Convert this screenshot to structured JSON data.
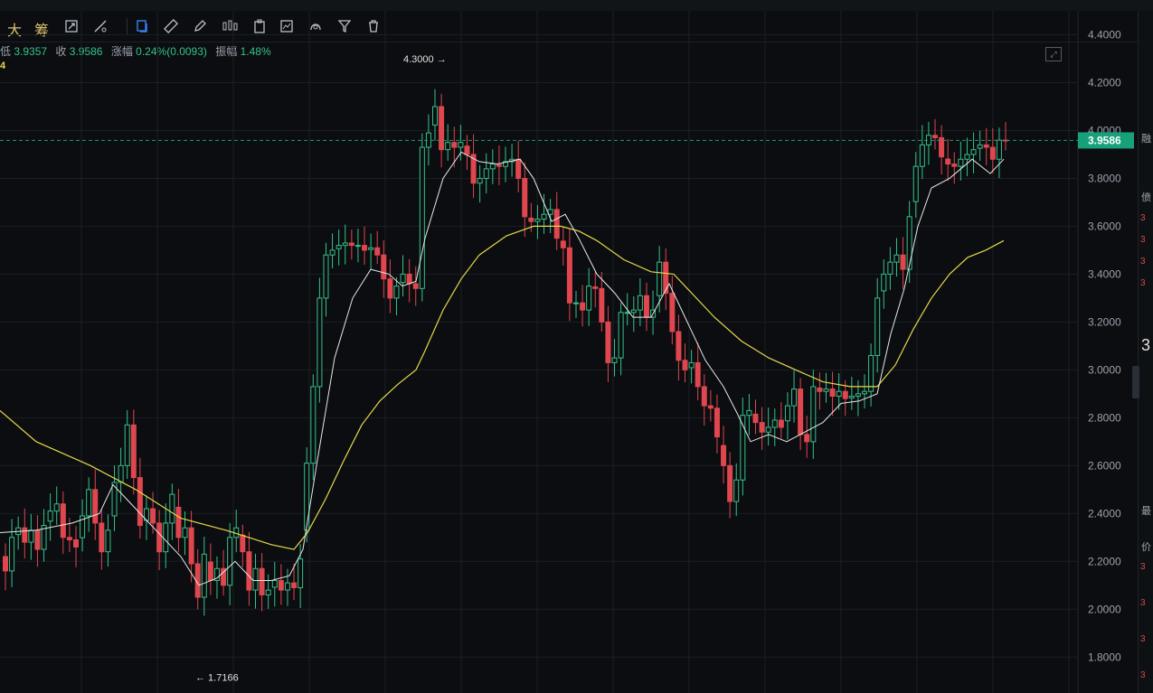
{
  "toolbar": {
    "label_da": "大",
    "label_chou": "筹",
    "icons": [
      "resize-icon",
      "line-tool-icon",
      "copy-icon",
      "ruler-icon",
      "pen-icon",
      "candles-icon",
      "clipboard-icon",
      "chart-edit-icon",
      "shape-icon",
      "filter-icon",
      "trash-icon"
    ]
  },
  "infobar": {
    "low_label": "低",
    "low_value": "3.9357",
    "close_label": "收",
    "close_value": "3.9586",
    "change_label": "涨幅",
    "change_value": "0.24%(0.0093)",
    "amplitude_label": "振幅",
    "amplitude_value": "1.48%"
  },
  "indicator_tag": "4",
  "colors": {
    "up": "#35c28a",
    "down": "#e0464e",
    "ma_white": "#e8e8e8",
    "ma_yellow": "#e6d84a",
    "price_tag_bg": "#17a07a",
    "grid": "#1b1f25"
  },
  "chart_data": {
    "type": "candlestick",
    "ylim": [
      1.65,
      4.5
    ],
    "yticks": [
      "4.4000",
      "4.2000",
      "4.0000",
      "3.8000",
      "3.6000",
      "3.4000",
      "3.2000",
      "3.0000",
      "2.8000",
      "2.6000",
      "2.4000",
      "2.2000",
      "2.0000",
      "1.8000"
    ],
    "current_price": "3.9586",
    "high_annotation": {
      "label": "4.3000 →",
      "value": 4.3
    },
    "low_annotation": {
      "label": "← 1.7166",
      "value": 1.7166
    },
    "closes": [
      2.16,
      2.3,
      2.34,
      2.28,
      2.33,
      2.25,
      2.35,
      2.41,
      2.44,
      2.3,
      2.29,
      2.26,
      2.39,
      2.5,
      2.36,
      2.24,
      2.33,
      2.53,
      2.6,
      2.77,
      2.55,
      2.35,
      2.42,
      2.36,
      2.24,
      2.36,
      2.48,
      2.3,
      2.34,
      2.19,
      2.05,
      2.23,
      2.12,
      2.17,
      2.1,
      2.3,
      2.34,
      2.24,
      2.08,
      2.17,
      2.06,
      2.08,
      2.12,
      2.08,
      2.11,
      2.09,
      2.21,
      2.61,
      2.93,
      3.3,
      3.48,
      3.5,
      3.52,
      3.53,
      3.52,
      3.52,
      3.5,
      3.51,
      3.48,
      3.38,
      3.3,
      3.35,
      3.4,
      3.36,
      3.34,
      3.93,
      3.99,
      4.1,
      3.92,
      3.95,
      3.93,
      3.95,
      3.9,
      3.78,
      3.8,
      3.84,
      3.86,
      3.85,
      3.87,
      3.88,
      3.8,
      3.64,
      3.62,
      3.63,
      3.65,
      3.67,
      3.55,
      3.51,
      3.28,
      3.28,
      3.25,
      3.35,
      3.34,
      3.2,
      3.03,
      3.05,
      3.24,
      3.24,
      3.25,
      3.31,
      3.22,
      3.25,
      3.45,
      3.32,
      3.16,
      3.04,
      3.0,
      3.03,
      2.93,
      2.85,
      2.84,
      2.72,
      2.6,
      2.45,
      2.54,
      2.81,
      2.83,
      2.78,
      2.74,
      2.76,
      2.79,
      2.76,
      2.85,
      2.92,
      2.73,
      2.7,
      2.93,
      2.91,
      2.92,
      2.89,
      2.91,
      2.88,
      2.89,
      2.9,
      2.91,
      3.06,
      3.3,
      3.4,
      3.45,
      3.48,
      3.42,
      3.64,
      3.85,
      3.94,
      3.98,
      3.97,
      3.89,
      3.86,
      3.85,
      3.88,
      3.9,
      3.92,
      3.94,
      3.93,
      3.88,
      3.96,
      3.9586
    ],
    "ma_yellow": [
      [
        0,
        2.83
      ],
      [
        40,
        2.7
      ],
      [
        100,
        2.6
      ],
      [
        150,
        2.5
      ],
      [
        200,
        2.38
      ],
      [
        250,
        2.33
      ],
      [
        300,
        2.27
      ],
      [
        325,
        2.25
      ],
      [
        340,
        2.32
      ],
      [
        360,
        2.46
      ],
      [
        380,
        2.62
      ],
      [
        400,
        2.77
      ],
      [
        420,
        2.87
      ],
      [
        440,
        2.94
      ],
      [
        460,
        3.0
      ],
      [
        470,
        3.08
      ],
      [
        490,
        3.25
      ],
      [
        510,
        3.38
      ],
      [
        530,
        3.48
      ],
      [
        560,
        3.56
      ],
      [
        590,
        3.6
      ],
      [
        620,
        3.6
      ],
      [
        640,
        3.58
      ],
      [
        660,
        3.54
      ],
      [
        690,
        3.46
      ],
      [
        720,
        3.41
      ],
      [
        745,
        3.4
      ],
      [
        760,
        3.34
      ],
      [
        790,
        3.22
      ],
      [
        820,
        3.12
      ],
      [
        850,
        3.05
      ],
      [
        880,
        3.0
      ],
      [
        910,
        2.95
      ],
      [
        940,
        2.93
      ],
      [
        970,
        2.93
      ],
      [
        990,
        3.02
      ],
      [
        1010,
        3.17
      ],
      [
        1030,
        3.3
      ],
      [
        1050,
        3.4
      ],
      [
        1070,
        3.47
      ],
      [
        1090,
        3.5
      ],
      [
        1110,
        3.54
      ]
    ],
    "ma_white": [
      [
        0,
        2.32
      ],
      [
        40,
        2.33
      ],
      [
        80,
        2.36
      ],
      [
        110,
        2.4
      ],
      [
        125,
        2.52
      ],
      [
        140,
        2.46
      ],
      [
        160,
        2.38
      ],
      [
        180,
        2.3
      ],
      [
        200,
        2.22
      ],
      [
        220,
        2.1
      ],
      [
        240,
        2.13
      ],
      [
        260,
        2.2
      ],
      [
        280,
        2.12
      ],
      [
        300,
        2.12
      ],
      [
        320,
        2.14
      ],
      [
        335,
        2.25
      ],
      [
        350,
        2.6
      ],
      [
        370,
        3.05
      ],
      [
        390,
        3.3
      ],
      [
        410,
        3.42
      ],
      [
        430,
        3.4
      ],
      [
        445,
        3.35
      ],
      [
        460,
        3.37
      ],
      [
        470,
        3.55
      ],
      [
        490,
        3.8
      ],
      [
        510,
        3.91
      ],
      [
        530,
        3.87
      ],
      [
        550,
        3.86
      ],
      [
        575,
        3.88
      ],
      [
        590,
        3.8
      ],
      [
        610,
        3.62
      ],
      [
        625,
        3.65
      ],
      [
        640,
        3.55
      ],
      [
        660,
        3.4
      ],
      [
        680,
        3.32
      ],
      [
        700,
        3.22
      ],
      [
        720,
        3.22
      ],
      [
        740,
        3.36
      ],
      [
        760,
        3.2
      ],
      [
        780,
        3.04
      ],
      [
        800,
        2.93
      ],
      [
        815,
        2.82
      ],
      [
        830,
        2.7
      ],
      [
        850,
        2.73
      ],
      [
        870,
        2.7
      ],
      [
        890,
        2.74
      ],
      [
        910,
        2.78
      ],
      [
        930,
        2.86
      ],
      [
        950,
        2.87
      ],
      [
        970,
        2.9
      ],
      [
        985,
        3.15
      ],
      [
        1000,
        3.34
      ],
      [
        1015,
        3.6
      ],
      [
        1030,
        3.76
      ],
      [
        1050,
        3.8
      ],
      [
        1075,
        3.88
      ],
      [
        1095,
        3.82
      ],
      [
        1110,
        3.88
      ]
    ],
    "title": "",
    "xlabel": "",
    "ylabel": ""
  }
}
